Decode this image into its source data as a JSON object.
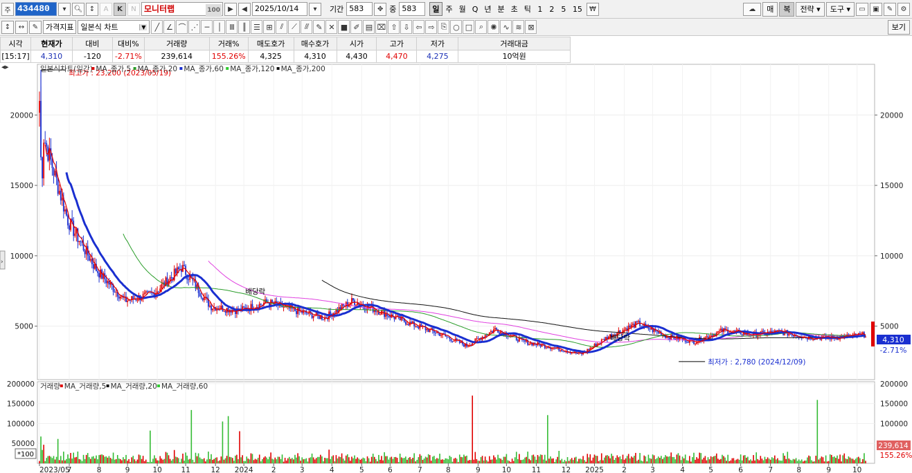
{
  "toolbar1": {
    "kind_label": "주",
    "stock_code": "434480",
    "k_label": "K",
    "a_label": "A",
    "n_label": "N",
    "stock_name": "모니터랩",
    "stock_name_badge": "100",
    "date": "2025/10/14",
    "period_label": "기간",
    "period_value": "583",
    "count_label": "중",
    "count_value": "583",
    "periods": [
      "일",
      "주",
      "월",
      "Q",
      "년",
      "분",
      "초",
      "틱",
      "1",
      "2",
      "5",
      "15"
    ],
    "active_period": "일",
    "right_buttons": [
      "매",
      "복",
      "전략",
      "도구"
    ]
  },
  "toolbar2": {
    "price_index_label": "가격지표",
    "chart_type_label": "일본식 차트",
    "view_label": "보기"
  },
  "quote": {
    "headers": [
      "시각",
      "현재가",
      "대비",
      "대비%",
      "거래량",
      "거래%",
      "매도호가",
      "매수호가",
      "시가",
      "고가",
      "저가",
      "거래대금"
    ],
    "values": [
      "[15:17]",
      "4,310",
      "-120",
      "-2.71%",
      "239,614",
      "155.26%",
      "4,325",
      "4,310",
      "4,430",
      "4,470",
      "4,275",
      "10억원"
    ]
  },
  "chart_data": [
    {
      "type": "candlestick",
      "legend": {
        "title": "일본식차트(일간)",
        "series": [
          {
            "name": "MA_종가,5",
            "color": "#e00000"
          },
          {
            "name": "MA_종가,20",
            "color": "#2a9d2a"
          },
          {
            "name": "MA_종가,60",
            "color": "#1a2fd0"
          },
          {
            "name": "MA_종가,120",
            "color": "#33cc33"
          },
          {
            "name": "MA_종가,200",
            "color": "#111111"
          }
        ]
      },
      "y_ticks": [
        5000,
        10000,
        15000,
        20000
      ],
      "ylim": [
        1200,
        23600
      ],
      "annotations": {
        "high": "최고가 : 23,200 (2023/05/19)",
        "low": "최저가 : 2,780 (2024/12/09)",
        "dividend_1": "배당락",
        "dividend_2": "배당락"
      },
      "current_price": "4,310",
      "current_change": "-2.71%",
      "trend_points": [
        [
          "2023/05",
          19500
        ],
        [
          "2023/06",
          12500
        ],
        [
          "2023/07",
          9000
        ],
        [
          "2023/08",
          6800
        ],
        [
          "2023/09",
          7300
        ],
        [
          "2023/10",
          9200
        ],
        [
          "2023/11",
          6400
        ],
        [
          "2023/12",
          6100
        ],
        [
          "2024/01",
          6700
        ],
        [
          "2024/02",
          6100
        ],
        [
          "2024/03",
          5600
        ],
        [
          "2024/04",
          6800
        ],
        [
          "2024/05",
          6000
        ],
        [
          "2024/06",
          5200
        ],
        [
          "2024/07",
          4500
        ],
        [
          "2024/08",
          3600
        ],
        [
          "2024/09",
          4800
        ],
        [
          "2024/10",
          3900
        ],
        [
          "2024/11",
          3500
        ],
        [
          "2024/12",
          3000
        ],
        [
          "2025/01",
          4300
        ],
        [
          "2025/02",
          5200
        ],
        [
          "2025/03",
          4300
        ],
        [
          "2025/04",
          3900
        ],
        [
          "2025/05",
          4700
        ],
        [
          "2025/06",
          4400
        ],
        [
          "2025/07",
          4600
        ],
        [
          "2025/08",
          4200
        ],
        [
          "2025/09",
          4200
        ],
        [
          "2025/10",
          4400
        ]
      ],
      "x_labels": [
        "2023/05",
        "7",
        "8",
        "9",
        "10",
        "11",
        "12",
        "2024",
        "2",
        "3",
        "4",
        "5",
        "6",
        "7",
        "8",
        "9",
        "10",
        "11",
        "12",
        "2025",
        "2",
        "3",
        "4",
        "5",
        "6",
        "7",
        "8",
        "9",
        "10"
      ]
    },
    {
      "type": "bar",
      "legend": {
        "title": "거래량",
        "series": [
          {
            "name": "MA_거래량,5",
            "color": "#e00000"
          },
          {
            "name": "MA_거래량,20",
            "color": "#111111"
          },
          {
            "name": "MA_거래량,60",
            "color": "#33cc33"
          }
        ]
      },
      "y_ticks": [
        50000,
        100000,
        150000,
        200000
      ],
      "ylim": [
        0,
        205000
      ],
      "scale_badge": "*100",
      "current_volume": "239,614",
      "current_volume_pct": "155.26%"
    }
  ],
  "colors": {
    "up": "#e00000",
    "down": "#1a2fd0",
    "accent_blue": "#1f64c8"
  }
}
